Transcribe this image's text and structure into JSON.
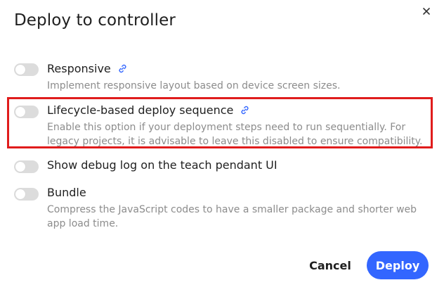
{
  "dialog": {
    "title": "Deploy to controller",
    "close_icon": "close-icon"
  },
  "options": [
    {
      "label": "Responsive",
      "description": "Implement responsive layout based on device screen sizes.",
      "enabled": false,
      "has_link": true
    },
    {
      "label": "Lifecycle-based deploy sequence",
      "description": "Enable this option if your deployment steps need to run sequentially. For legacy projects, it is advisable to leave this disabled to ensure compatibility.",
      "enabled": false,
      "has_link": true,
      "highlighted": true
    },
    {
      "label": "Show debug log on the teach pendant UI",
      "description": "",
      "enabled": false,
      "has_link": false
    },
    {
      "label": "Bundle",
      "description": "Compress the JavaScript codes to have a smaller package and shorter web app load time.",
      "enabled": false,
      "has_link": false
    }
  ],
  "footer": {
    "cancel_label": "Cancel",
    "deploy_label": "Deploy"
  },
  "colors": {
    "accent": "#3366ff",
    "highlight_border": "#e01c1c",
    "toggle_off": "#dcdcdc",
    "description_text": "#8c8c8c",
    "link_icon": "#3366ff"
  }
}
